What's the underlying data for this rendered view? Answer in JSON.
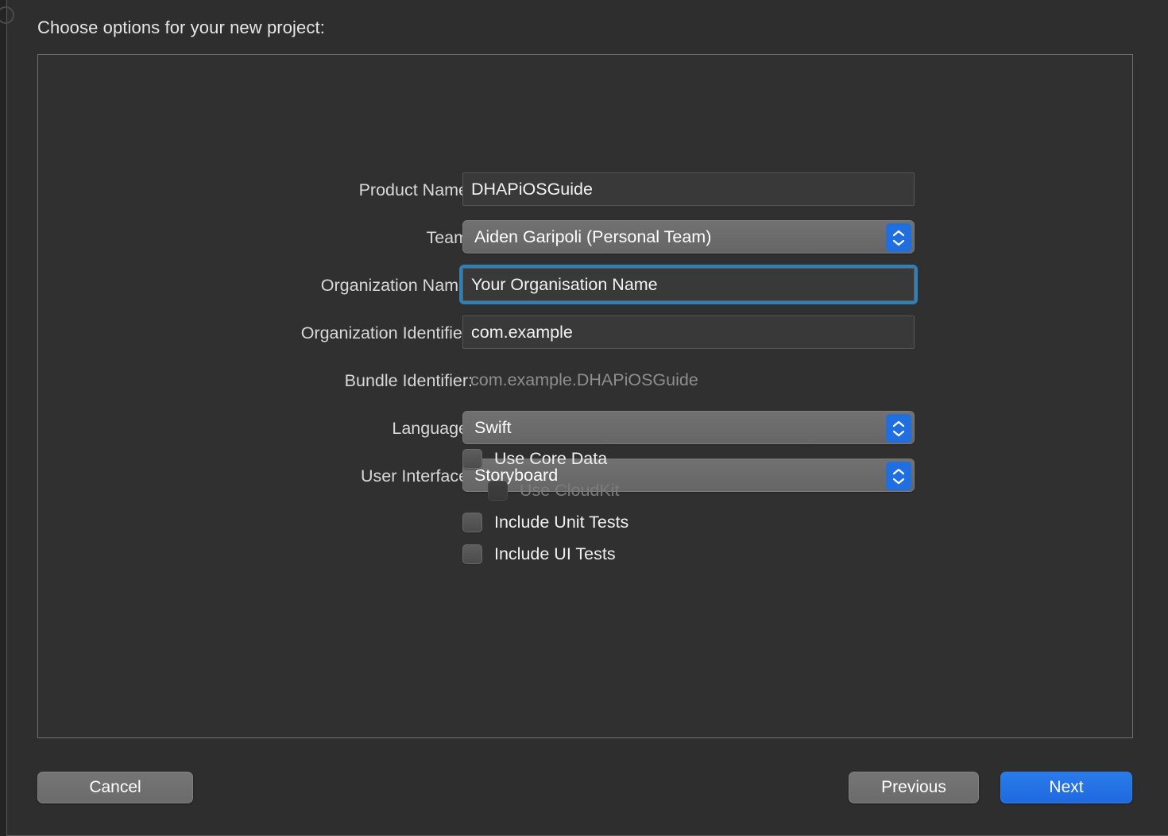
{
  "sheet": {
    "title": "Choose options for your new project:"
  },
  "form": {
    "rows": [
      {
        "label": "Product Name:",
        "value": "DHAPiOSGuide",
        "type": "textfield"
      },
      {
        "label": "Team:",
        "value": "Aiden Garipoli (Personal Team)",
        "type": "popup"
      },
      {
        "label": "Organization Name:",
        "value": "Your Organisation Name",
        "type": "textfield-focused"
      },
      {
        "label": "Organization Identifier:",
        "value": "com.example",
        "type": "textfield"
      },
      {
        "label": "Bundle Identifier:",
        "value": "com.example.DHAPiOSGuide",
        "type": "static"
      },
      {
        "label": "Language:",
        "value": "Swift",
        "type": "popup"
      },
      {
        "label": "User Interface:",
        "value": "Storyboard",
        "type": "popup"
      }
    ]
  },
  "checkboxes": [
    {
      "label": "Use Core Data",
      "checked": false,
      "disabled": false,
      "indented": false
    },
    {
      "label": "Use CloudKit",
      "checked": false,
      "disabled": true,
      "indented": true
    },
    {
      "label": "Include Unit Tests",
      "checked": false,
      "disabled": false,
      "indented": false
    },
    {
      "label": "Include UI Tests",
      "checked": false,
      "disabled": false,
      "indented": false
    }
  ],
  "footer": {
    "cancel_label": "Cancel",
    "previous_label": "Previous",
    "next_label": "Next"
  },
  "icons": {
    "stepper": "chevron-up-down-icon"
  },
  "colors": {
    "window_background": "#2e2e2e",
    "panel_background": "#303030",
    "panel_border": "#6e6e6e",
    "textfield_background": "#393939",
    "popup_background": "#6b6b6b",
    "focus_ring": "#2f80b7",
    "stepper_blue": "#1f6fe0",
    "accent_blue": "#1f69e0",
    "label_text": "#d8d8d8",
    "disabled_text": "#8e8e8e"
  }
}
